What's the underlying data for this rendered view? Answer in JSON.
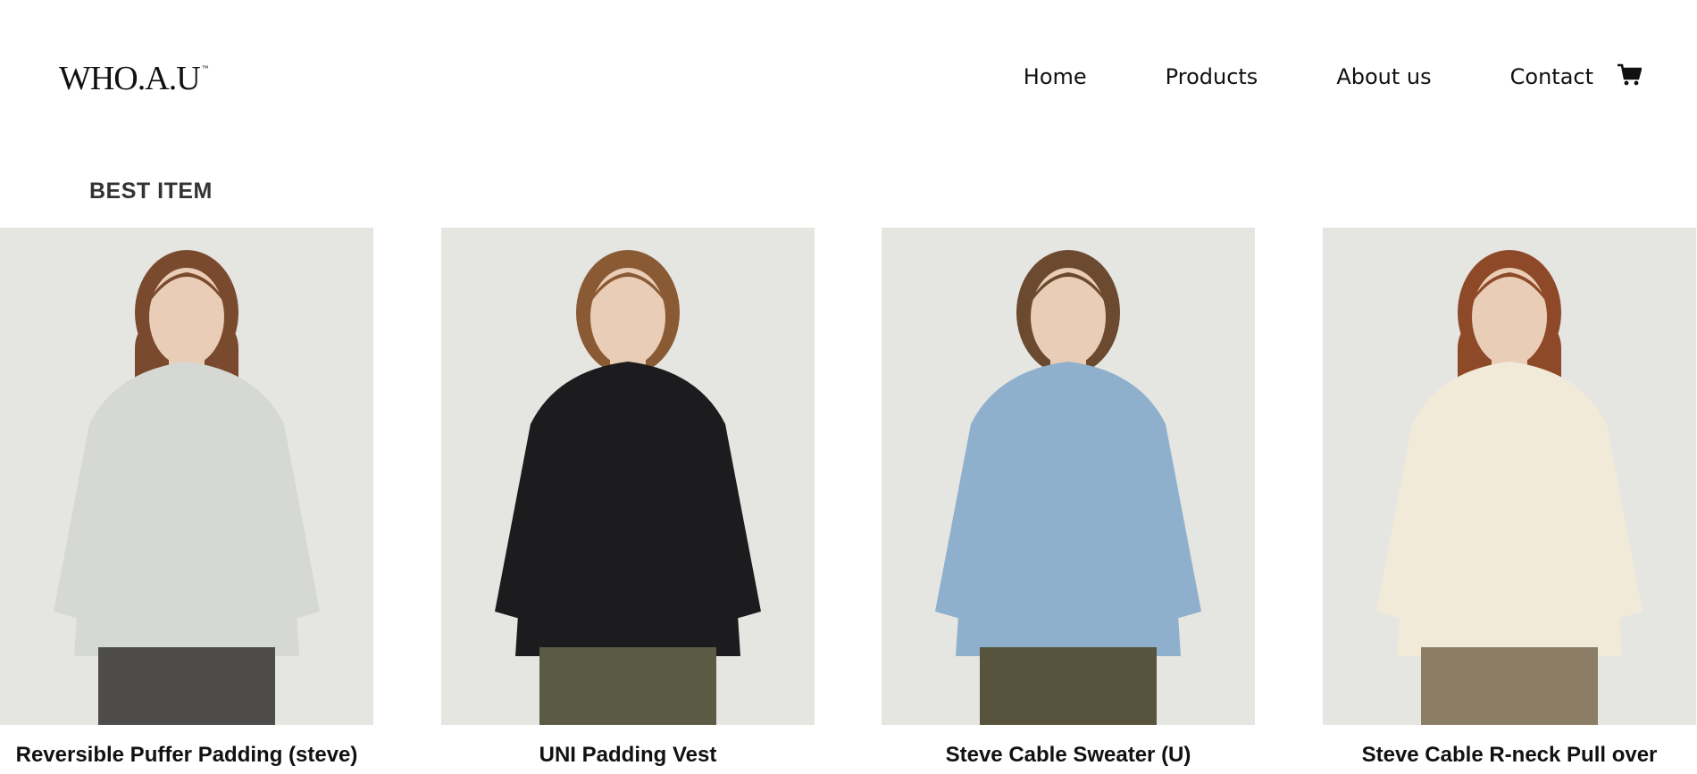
{
  "header": {
    "logo_text": "WHO.A.U",
    "logo_mark": "™",
    "nav": [
      "Home",
      "Products",
      "About us",
      "Contact"
    ],
    "cart_icon": "cart-icon"
  },
  "section": {
    "title": "BEST ITEM"
  },
  "products": [
    {
      "name": "Reversible Puffer Padding (steve)",
      "top_color": "#d6d8d6",
      "bottom_color": "#4d4c4a",
      "hair_color": "#7a4a2e"
    },
    {
      "name": "UNI Padding Vest",
      "top_color": "#1c1c1e",
      "bottom_color": "#5b5a45",
      "hair_color": "#8a5a34"
    },
    {
      "name": "Steve Cable Sweater (U)",
      "top_color": "#8fb0cc",
      "bottom_color": "#57533c",
      "hair_color": "#6b4a30"
    },
    {
      "name": "Steve Cable R-neck Pull over",
      "top_color": "#f2ead8",
      "bottom_color": "#8b7d66",
      "hair_color": "#8e4a28"
    }
  ],
  "colors": {
    "photo_bg": "#e5e5e2",
    "skin": "#e9cdb6"
  }
}
